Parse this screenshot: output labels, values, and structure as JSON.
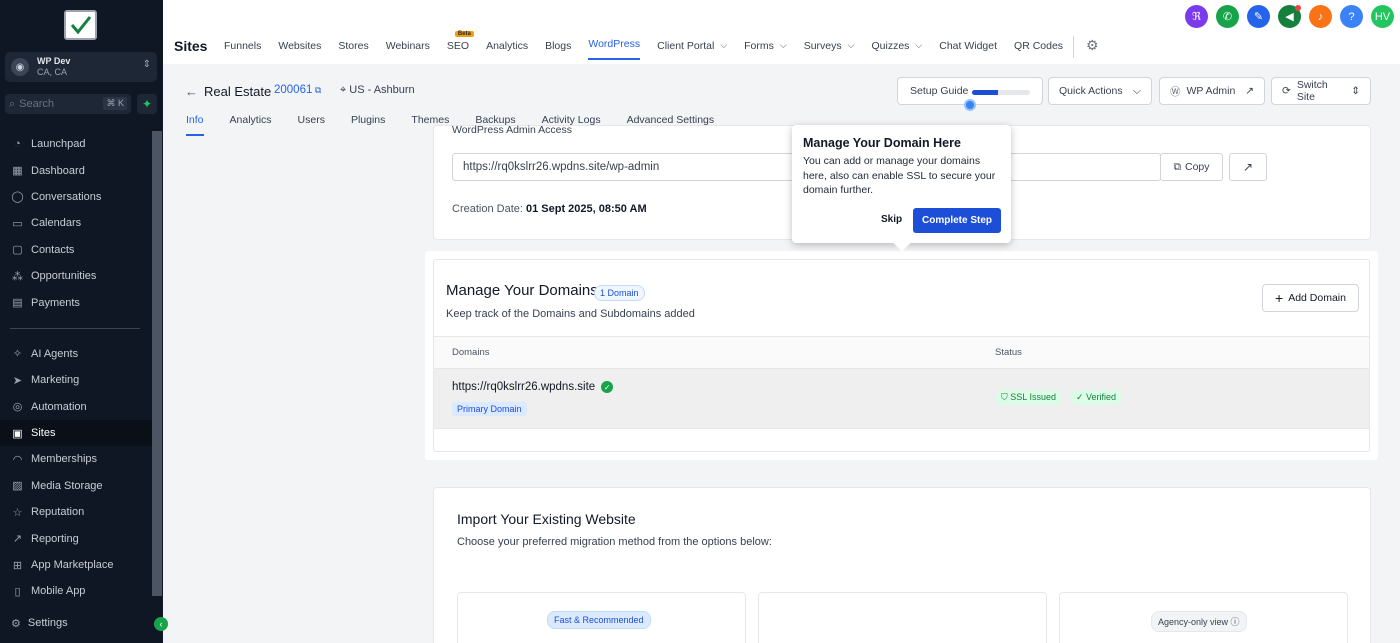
{
  "sidebar": {
    "account": {
      "name": "WP Dev",
      "location": "CA, CA"
    },
    "search": {
      "placeholder": "Search",
      "shortcut": "⌘ K"
    },
    "items_top": [
      {
        "label": "Launchpad",
        "icon": "rocket-icon"
      },
      {
        "label": "Dashboard",
        "icon": "dashboard-icon"
      },
      {
        "label": "Conversations",
        "icon": "chat-icon"
      },
      {
        "label": "Calendars",
        "icon": "calendar-icon"
      },
      {
        "label": "Contacts",
        "icon": "contacts-icon"
      },
      {
        "label": "Opportunities",
        "icon": "opportunities-icon"
      },
      {
        "label": "Payments",
        "icon": "payments-icon"
      }
    ],
    "items_bottom": [
      {
        "label": "AI Agents",
        "icon": "ai-icon"
      },
      {
        "label": "Marketing",
        "icon": "send-icon"
      },
      {
        "label": "Automation",
        "icon": "automation-icon"
      },
      {
        "label": "Sites",
        "icon": "sites-icon",
        "active": true
      },
      {
        "label": "Memberships",
        "icon": "membership-icon"
      },
      {
        "label": "Media Storage",
        "icon": "media-icon"
      },
      {
        "label": "Reputation",
        "icon": "star-icon"
      },
      {
        "label": "Reporting",
        "icon": "reporting-icon"
      },
      {
        "label": "App Marketplace",
        "icon": "marketplace-icon"
      },
      {
        "label": "Mobile App",
        "icon": "mobile-icon"
      }
    ],
    "settings": "Settings"
  },
  "topbar": {
    "brand": "Sites",
    "nav": [
      {
        "label": "Funnels"
      },
      {
        "label": "Websites"
      },
      {
        "label": "Stores"
      },
      {
        "label": "Webinars"
      },
      {
        "label": "SEO",
        "badge": "Beta"
      },
      {
        "label": "Analytics"
      },
      {
        "label": "Blogs"
      },
      {
        "label": "WordPress",
        "active": true
      },
      {
        "label": "Client Portal",
        "dropdown": true
      },
      {
        "label": "Forms",
        "dropdown": true
      },
      {
        "label": "Surveys",
        "dropdown": true
      },
      {
        "label": "Quizzes",
        "dropdown": true
      },
      {
        "label": "Chat Widget"
      },
      {
        "label": "QR Codes"
      }
    ],
    "icons": [
      {
        "name": "translate-icon",
        "color": "#7c3aed"
      },
      {
        "name": "phone-icon",
        "color": "#16a34a"
      },
      {
        "name": "magic-icon",
        "color": "#2563eb"
      },
      {
        "name": "megaphone-icon",
        "color": "#15803d"
      },
      {
        "name": "bell-icon",
        "color": "#f97316"
      },
      {
        "name": "help-icon",
        "color": "#3b82f6"
      },
      {
        "name": "avatar",
        "color": "#22c55e",
        "text": "HV"
      }
    ]
  },
  "header": {
    "title": "Real Estate",
    "site_id": "200061",
    "location": "US - Ashburn",
    "setup_guide": "Setup Guide",
    "setup_progress": 0.45,
    "quick_actions": "Quick Actions",
    "wp_admin": "WP Admin",
    "switch_site": "Switch Site",
    "tabs": [
      {
        "label": "Info",
        "active": true
      },
      {
        "label": "Analytics"
      },
      {
        "label": "Users"
      },
      {
        "label": "Plugins"
      },
      {
        "label": "Themes"
      },
      {
        "label": "Backups"
      },
      {
        "label": "Activity Logs"
      },
      {
        "label": "Advanced Settings"
      }
    ]
  },
  "access": {
    "label": "WordPress Admin Access",
    "url": "https://rq0kslrr26.wpdns.site/wp-admin",
    "copy": "Copy",
    "creation_label": "Creation Date:",
    "creation_date": "01 Sept 2025, 08:50 AM"
  },
  "domains": {
    "title": "Manage Your Domains",
    "count_badge": "1 Domain",
    "subtitle": "Keep track of the Domains and Subdomains added",
    "add_button": "Add Domain",
    "columns": [
      "Domains",
      "Status"
    ],
    "rows": [
      {
        "url": "https://rq0kslrr26.wpdns.site",
        "tag": "Primary Domain",
        "ssl": "SSL Issued",
        "verified": "Verified"
      }
    ]
  },
  "import": {
    "title": "Import Your Existing Website",
    "subtitle": "Choose your preferred migration method from the options below:",
    "badge1": "Fast & Recommended",
    "badge3": "Agency-only view"
  },
  "popover": {
    "title": "Manage Your Domain Here",
    "body": "You can add or manage your domains here, also can enable SSL to secure your domain further.",
    "skip": "Skip",
    "complete": "Complete Step"
  }
}
